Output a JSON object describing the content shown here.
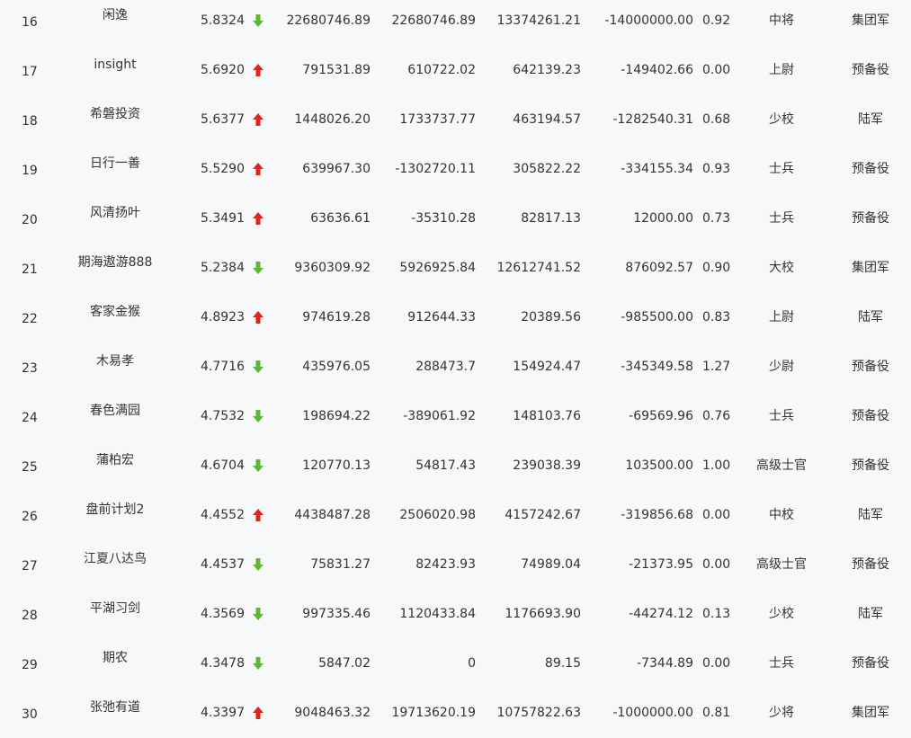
{
  "colors": {
    "background": "#f7f8fa",
    "text": "#333333",
    "up": "#e2231a",
    "down": "#5cb82e"
  },
  "rows": [
    {
      "rank": "16",
      "name": "闲逸",
      "score": "5.8324",
      "trend": "down",
      "c1": "22680746.89",
      "c2": "22680746.89",
      "c3": "13374261.21",
      "c4": "-14000000.00",
      "ratio": "0.92",
      "title": "中将",
      "army": "集团军"
    },
    {
      "rank": "17",
      "name": "insight",
      "score": "5.6920",
      "trend": "up",
      "c1": "791531.89",
      "c2": "610722.02",
      "c3": "642139.23",
      "c4": "-149402.66",
      "ratio": "0.00",
      "title": "上尉",
      "army": "预备役"
    },
    {
      "rank": "18",
      "name": "希磐投资",
      "score": "5.6377",
      "trend": "up",
      "c1": "1448026.20",
      "c2": "1733737.77",
      "c3": "463194.57",
      "c4": "-1282540.31",
      "ratio": "0.68",
      "title": "少校",
      "army": "陆军"
    },
    {
      "rank": "19",
      "name": "日行一善",
      "score": "5.5290",
      "trend": "up",
      "c1": "639967.30",
      "c2": "-1302720.11",
      "c3": "305822.22",
      "c4": "-334155.34",
      "ratio": "0.93",
      "title": "士兵",
      "army": "预备役"
    },
    {
      "rank": "20",
      "name": "风清扬叶",
      "score": "5.3491",
      "trend": "up",
      "c1": "63636.61",
      "c2": "-35310.28",
      "c3": "82817.13",
      "c4": "12000.00",
      "ratio": "0.73",
      "title": "士兵",
      "army": "预备役"
    },
    {
      "rank": "21",
      "name": "期海遨游888",
      "score": "5.2384",
      "trend": "down",
      "c1": "9360309.92",
      "c2": "5926925.84",
      "c3": "12612741.52",
      "c4": "876092.57",
      "ratio": "0.90",
      "title": "大校",
      "army": "集团军"
    },
    {
      "rank": "22",
      "name": "客家金猴",
      "score": "4.8923",
      "trend": "up",
      "c1": "974619.28",
      "c2": "912644.33",
      "c3": "20389.56",
      "c4": "-985500.00",
      "ratio": "0.83",
      "title": "上尉",
      "army": "陆军"
    },
    {
      "rank": "23",
      "name": "木易孝",
      "score": "4.7716",
      "trend": "down",
      "c1": "435976.05",
      "c2": "288473.7",
      "c3": "154924.47",
      "c4": "-345349.58",
      "ratio": "1.27",
      "title": "少尉",
      "army": "预备役"
    },
    {
      "rank": "24",
      "name": "春色满园",
      "score": "4.7532",
      "trend": "down",
      "c1": "198694.22",
      "c2": "-389061.92",
      "c3": "148103.76",
      "c4": "-69569.96",
      "ratio": "0.76",
      "title": "士兵",
      "army": "预备役"
    },
    {
      "rank": "25",
      "name": "蒲柏宏",
      "score": "4.6704",
      "trend": "down",
      "c1": "120770.13",
      "c2": "54817.43",
      "c3": "239038.39",
      "c4": "103500.00",
      "ratio": "1.00",
      "title": "高级士官",
      "army": "预备役"
    },
    {
      "rank": "26",
      "name": "盘前计划2",
      "score": "4.4552",
      "trend": "up",
      "c1": "4438487.28",
      "c2": "2506020.98",
      "c3": "4157242.67",
      "c4": "-319856.68",
      "ratio": "0.00",
      "title": "中校",
      "army": "陆军"
    },
    {
      "rank": "27",
      "name": "江夏八达鸟",
      "score": "4.4537",
      "trend": "down",
      "c1": "75831.27",
      "c2": "82423.93",
      "c3": "74989.04",
      "c4": "-21373.95",
      "ratio": "0.00",
      "title": "高级士官",
      "army": "预备役"
    },
    {
      "rank": "28",
      "name": "平湖习剑",
      "score": "4.3569",
      "trend": "down",
      "c1": "997335.46",
      "c2": "1120433.84",
      "c3": "1176693.90",
      "c4": "-44274.12",
      "ratio": "0.13",
      "title": "少校",
      "army": "陆军"
    },
    {
      "rank": "29",
      "name": "期农",
      "score": "4.3478",
      "trend": "down",
      "c1": "5847.02",
      "c2": "0",
      "c3": "89.15",
      "c4": "-7344.89",
      "ratio": "0.00",
      "title": "士兵",
      "army": "预备役"
    },
    {
      "rank": "30",
      "name": "张弛有道",
      "score": "4.3397",
      "trend": "up",
      "c1": "9048463.32",
      "c2": "19713620.19",
      "c3": "10757822.63",
      "c4": "-1000000.00",
      "ratio": "0.81",
      "title": "少将",
      "army": "集团军"
    }
  ]
}
